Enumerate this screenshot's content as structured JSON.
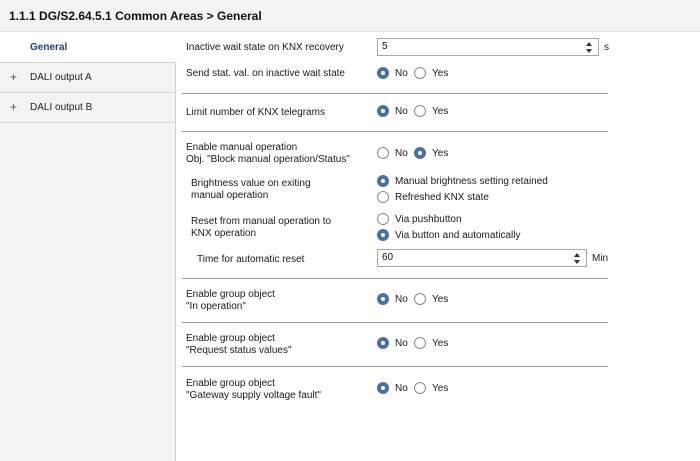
{
  "header": {
    "title": "1.1.1 DG/S2.64.5.1 Common Areas > General"
  },
  "sidebar": {
    "items": [
      {
        "label": "General"
      },
      {
        "label": "DALI output A",
        "expander": "+"
      },
      {
        "label": "DALI output B",
        "expander": "+"
      }
    ]
  },
  "params": {
    "inactive_wait": {
      "label": "Inactive wait state on KNX recovery",
      "value": "5",
      "unit": "s"
    },
    "send_stat": {
      "label": "Send stat. val. on inactive wait state",
      "options": [
        "No",
        "Yes"
      ],
      "selected": "No"
    },
    "limit_telegrams": {
      "label": "Limit number of KNX telegrams",
      "options": [
        "No",
        "Yes"
      ],
      "selected": "No"
    },
    "manual_op": {
      "label_line1": "Enable manual operation",
      "label_line2": "Obj. \"Block manual operation/Status\"",
      "options": [
        "No",
        "Yes"
      ],
      "selected": "Yes"
    },
    "brightness_exit": {
      "label_line1": "Brightness value on exiting",
      "label_line2": "manual operation",
      "options": [
        "Manual brightness setting retained",
        "Refreshed KNX state"
      ],
      "selected": "Manual brightness setting retained"
    },
    "reset_manual": {
      "label_line1": "Reset from manual operation to",
      "label_line2": "KNX operation",
      "options": [
        "Via pushbutton",
        "Via button and automatically"
      ],
      "selected": "Via button and automatically"
    },
    "auto_reset_time": {
      "label": "Time for automatic reset",
      "value": "60",
      "unit": "Min"
    },
    "in_operation": {
      "label_line1": "Enable group object",
      "label_line2": "\"In operation\"",
      "options": [
        "No",
        "Yes"
      ],
      "selected": "No"
    },
    "request_status": {
      "label_line1": "Enable group object",
      "label_line2": "\"Request status values\"",
      "options": [
        "No",
        "Yes"
      ],
      "selected": "No"
    },
    "supply_fault": {
      "label_line1": "Enable group object",
      "label_line2": "\"Gateway supply voltage fault\"",
      "options": [
        "No",
        "Yes"
      ],
      "selected": "No"
    }
  },
  "colors": {
    "accent": "#4a6fa5",
    "sidebar_active_text": "#1d3f75",
    "sidebar_bg": "#f3f3f3"
  }
}
